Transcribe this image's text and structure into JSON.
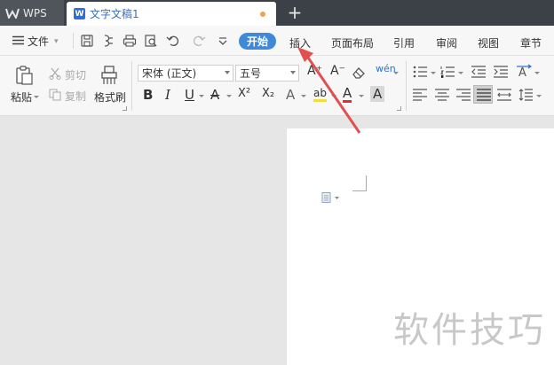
{
  "titlebar": {
    "app_tab": "WPS",
    "doc_tab": "文字文稿1",
    "doc_badge": "W",
    "new_tab": "+"
  },
  "menubar": {
    "file": "文件",
    "tabs": [
      "开始",
      "插入",
      "页面布局",
      "引用",
      "审阅",
      "视图",
      "章节"
    ]
  },
  "ribbon": {
    "paste": "粘贴",
    "cut": "剪切",
    "copy": "复制",
    "format_painter": "格式刷",
    "font_name": "宋体 (正文)",
    "font_size": "五号",
    "bold": "B",
    "italic": "I",
    "underline": "U",
    "strike": "A",
    "superscript": "X²",
    "subscript": "X₂",
    "text_effect": "A",
    "highlight": "ab",
    "font_color": "A",
    "char_shade": "A",
    "grow_font": "A⁺",
    "shrink_font": "A⁻",
    "phonetic": "wén"
  },
  "document": {
    "watermark": "软件技巧"
  },
  "colors": {
    "accent": "#3f8ad8",
    "titlebar": "#3c4148",
    "arrow": "#e05050"
  }
}
